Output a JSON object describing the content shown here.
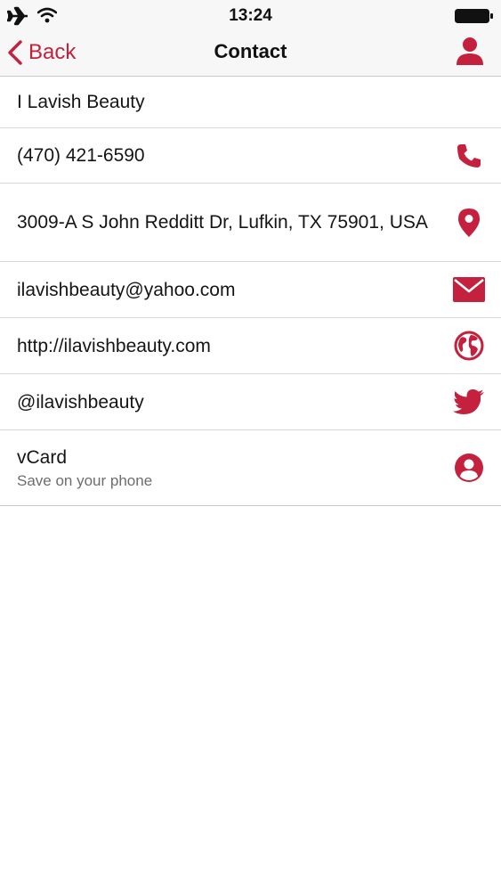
{
  "status_bar": {
    "time": "13:24",
    "icons": [
      "airplane-icon",
      "wifi-icon",
      "battery-icon"
    ]
  },
  "nav": {
    "back_label": "Back",
    "title": "Contact",
    "right_icon": "person-icon"
  },
  "colors": {
    "accent": "#c3213d",
    "bar_background": "#f7f7f7",
    "separator": "#d9d9d9"
  },
  "contact": {
    "name": "I Lavish Beauty",
    "phone": "(470) 421-6590",
    "address": "3009-A S John Redditt Dr, Lufkin, TX 75901, USA",
    "email": "ilavishbeauty@yahoo.com",
    "website": "http://ilavishbeauty.com",
    "twitter": "@ilavishbeauty",
    "vcard": {
      "title": "vCard",
      "subtitle": "Save on your phone"
    }
  },
  "row_icons": [
    "phone-icon",
    "location-pin-icon",
    "envelope-icon",
    "globe-icon",
    "twitter-bird-icon",
    "user-circle-icon"
  ]
}
